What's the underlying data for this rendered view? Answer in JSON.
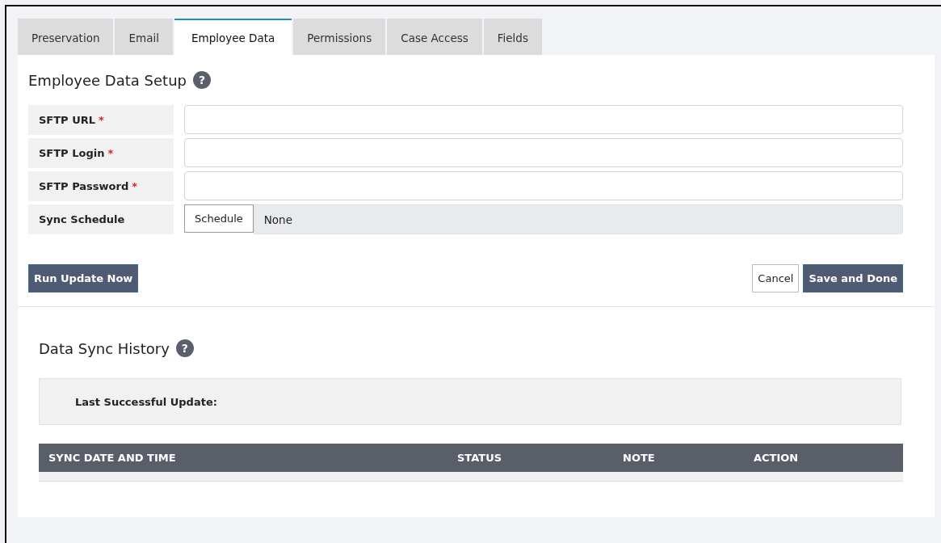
{
  "tabs": [
    {
      "label": "Preservation",
      "selected": false
    },
    {
      "label": "Email",
      "selected": false
    },
    {
      "label": "Employee Data",
      "selected": true
    },
    {
      "label": "Permissions",
      "selected": false
    },
    {
      "label": "Case Access",
      "selected": false
    },
    {
      "label": "Fields",
      "selected": false
    }
  ],
  "setup": {
    "title": "Employee Data Setup",
    "help": "?",
    "fields": [
      {
        "kind": "text",
        "label": "SFTP URL",
        "required_mark": "*"
      },
      {
        "kind": "text",
        "label": "SFTP Login",
        "required_mark": "*"
      },
      {
        "kind": "password",
        "label": "SFTP Password",
        "required_mark": "*"
      },
      {
        "kind": "schedule",
        "label": "Sync Schedule",
        "button": "Schedule",
        "value": "None"
      }
    ],
    "run_button": "Run Update Now",
    "cancel_button": "Cancel",
    "save_button": "Save and Done"
  },
  "history": {
    "title": "Data Sync History",
    "help": "?",
    "last_update_label": "Last Successful Update:",
    "table": {
      "columns": [
        "SYNC DATE AND TIME",
        "STATUS",
        "NOTE",
        "ACTION"
      ]
    }
  }
}
